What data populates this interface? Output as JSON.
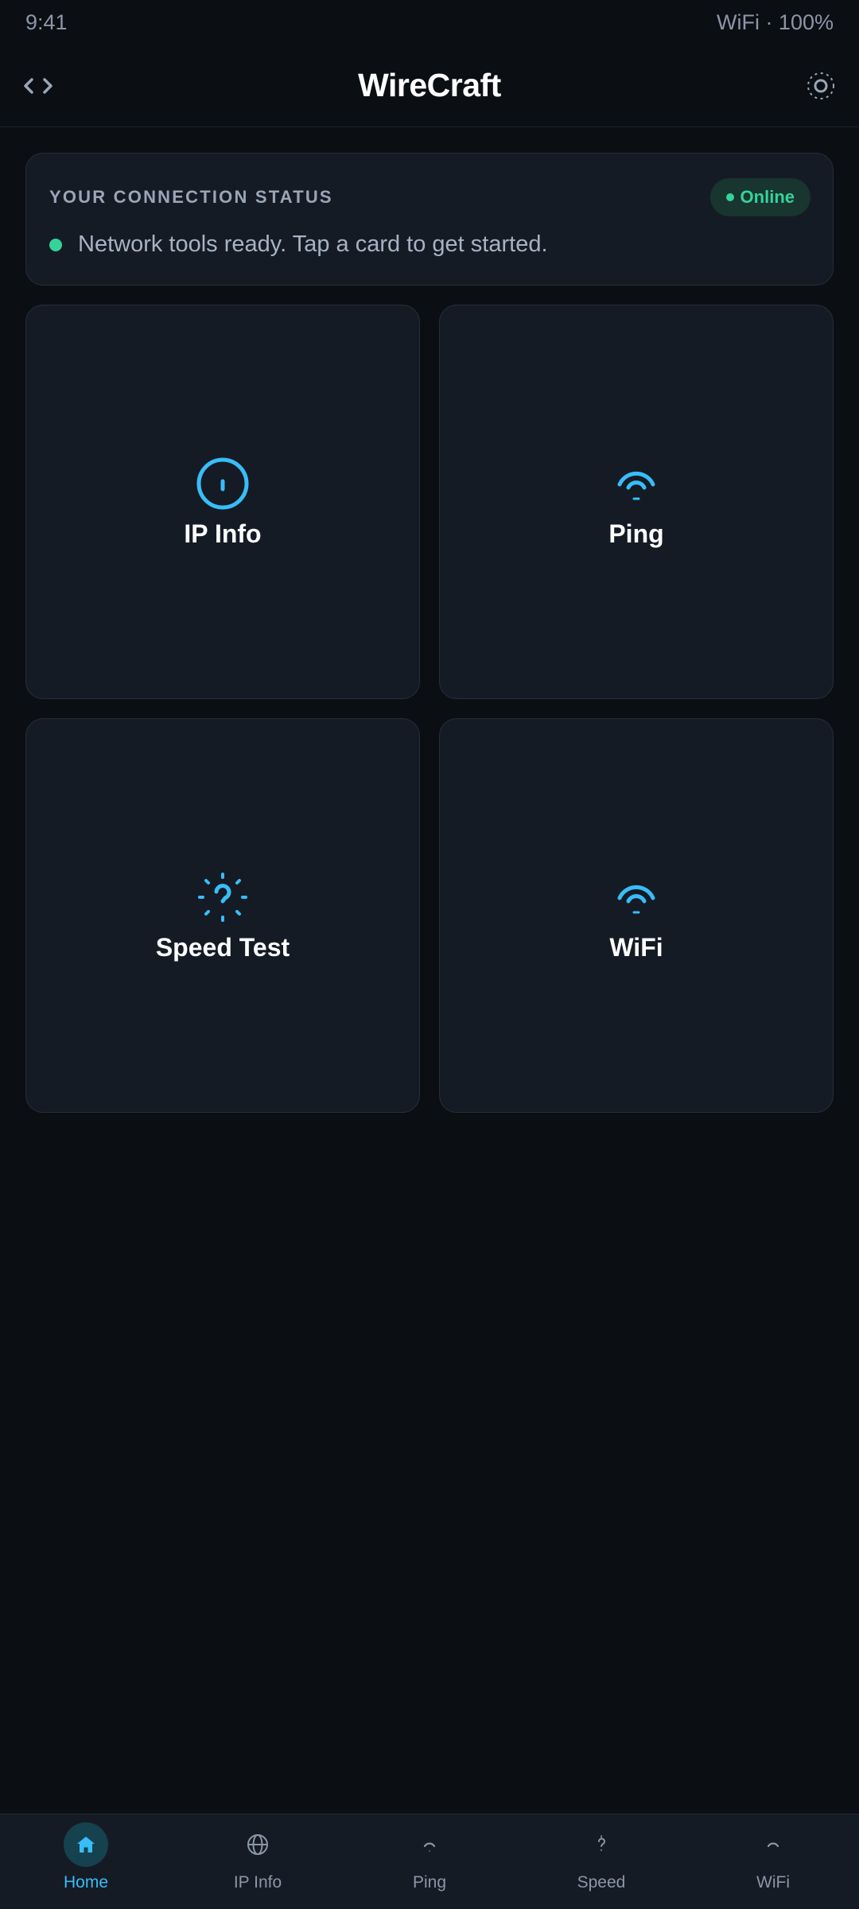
{
  "status_bar": {
    "time": "9:41",
    "connectivity": "WiFi · 100%"
  },
  "header": {
    "title": "WireCraft",
    "left_icon": "code-icon",
    "right_icon": "gear-icon"
  },
  "status_card": {
    "label": "YOUR CONNECTION STATUS",
    "badge": "Online",
    "message": "Network tools ready. Tap a card to get started."
  },
  "tools": [
    {
      "label": "IP Info",
      "icon": "info-icon"
    },
    {
      "label": "Ping",
      "icon": "wifi-icon"
    },
    {
      "label": "Speed Test",
      "icon": "speed-icon"
    },
    {
      "label": "WiFi",
      "icon": "wifi-icon"
    }
  ],
  "nav": {
    "items": [
      {
        "label": "Home",
        "icon": "home-icon",
        "active": true
      },
      {
        "label": "IP Info",
        "icon": "globe-icon",
        "active": false
      },
      {
        "label": "Ping",
        "icon": "ping-icon",
        "active": false
      },
      {
        "label": "Speed",
        "icon": "speed-icon",
        "active": false
      },
      {
        "label": "WiFi",
        "icon": "wifi-icon",
        "active": false
      }
    ]
  },
  "colors": {
    "background": "#0b0e13",
    "card": "#151b24",
    "accent": "#38bdf8",
    "online": "#34d399"
  }
}
